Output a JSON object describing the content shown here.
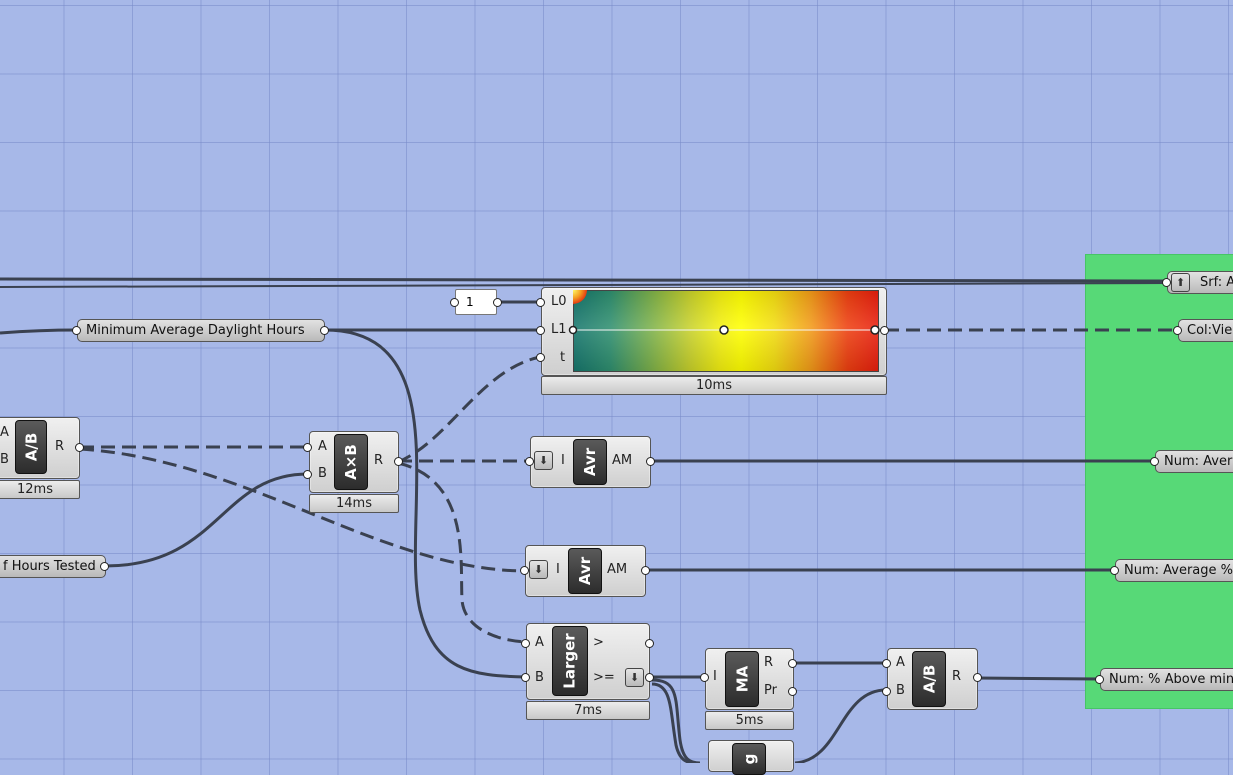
{
  "canvas": {
    "background_color": "#a7b8e8",
    "group_color": "#57d977",
    "wire_color": "#3a4150"
  },
  "params": {
    "min_avg_daylight": "Minimum Average Daylight Hours",
    "hours_tested": "f Hours Tested",
    "panel_value": "1"
  },
  "gradient": {
    "inputs": [
      "L0",
      "L1",
      "t"
    ],
    "timer": "10ms"
  },
  "divide": {
    "inputs": [
      "A",
      "B"
    ],
    "output": "R",
    "icon": "A/B",
    "timer": "12ms"
  },
  "multiply": {
    "inputs": [
      "A",
      "B"
    ],
    "output": "R",
    "icon": "A×B",
    "timer": "14ms"
  },
  "average1": {
    "input": "I",
    "output": "AM",
    "icon": "Avr",
    "flatten_icon": "down-arrow-icon"
  },
  "average2": {
    "input": "I",
    "output": "AM",
    "icon": "Avr",
    "flatten_icon": "down-arrow-icon"
  },
  "larger": {
    "inputs": [
      "A",
      "B"
    ],
    "outputs": [
      ">",
      ">="
    ],
    "icon": "Larger",
    "timer": "7ms"
  },
  "mass_addition": {
    "input": "I",
    "outputs": [
      "R",
      "Pr"
    ],
    "icon": "MA",
    "timer": "5ms"
  },
  "divide2": {
    "inputs": [
      "A",
      "B"
    ],
    "output": "R",
    "icon": "A/B"
  },
  "partial_component": {
    "icon": "g"
  },
  "outputs_group": {
    "srf": "Srf: A",
    "colview": "Col:Vie",
    "num_avg": "Num: Aver",
    "num_avg_pct": "Num: Average %",
    "num_above": "Num: % Above min"
  }
}
